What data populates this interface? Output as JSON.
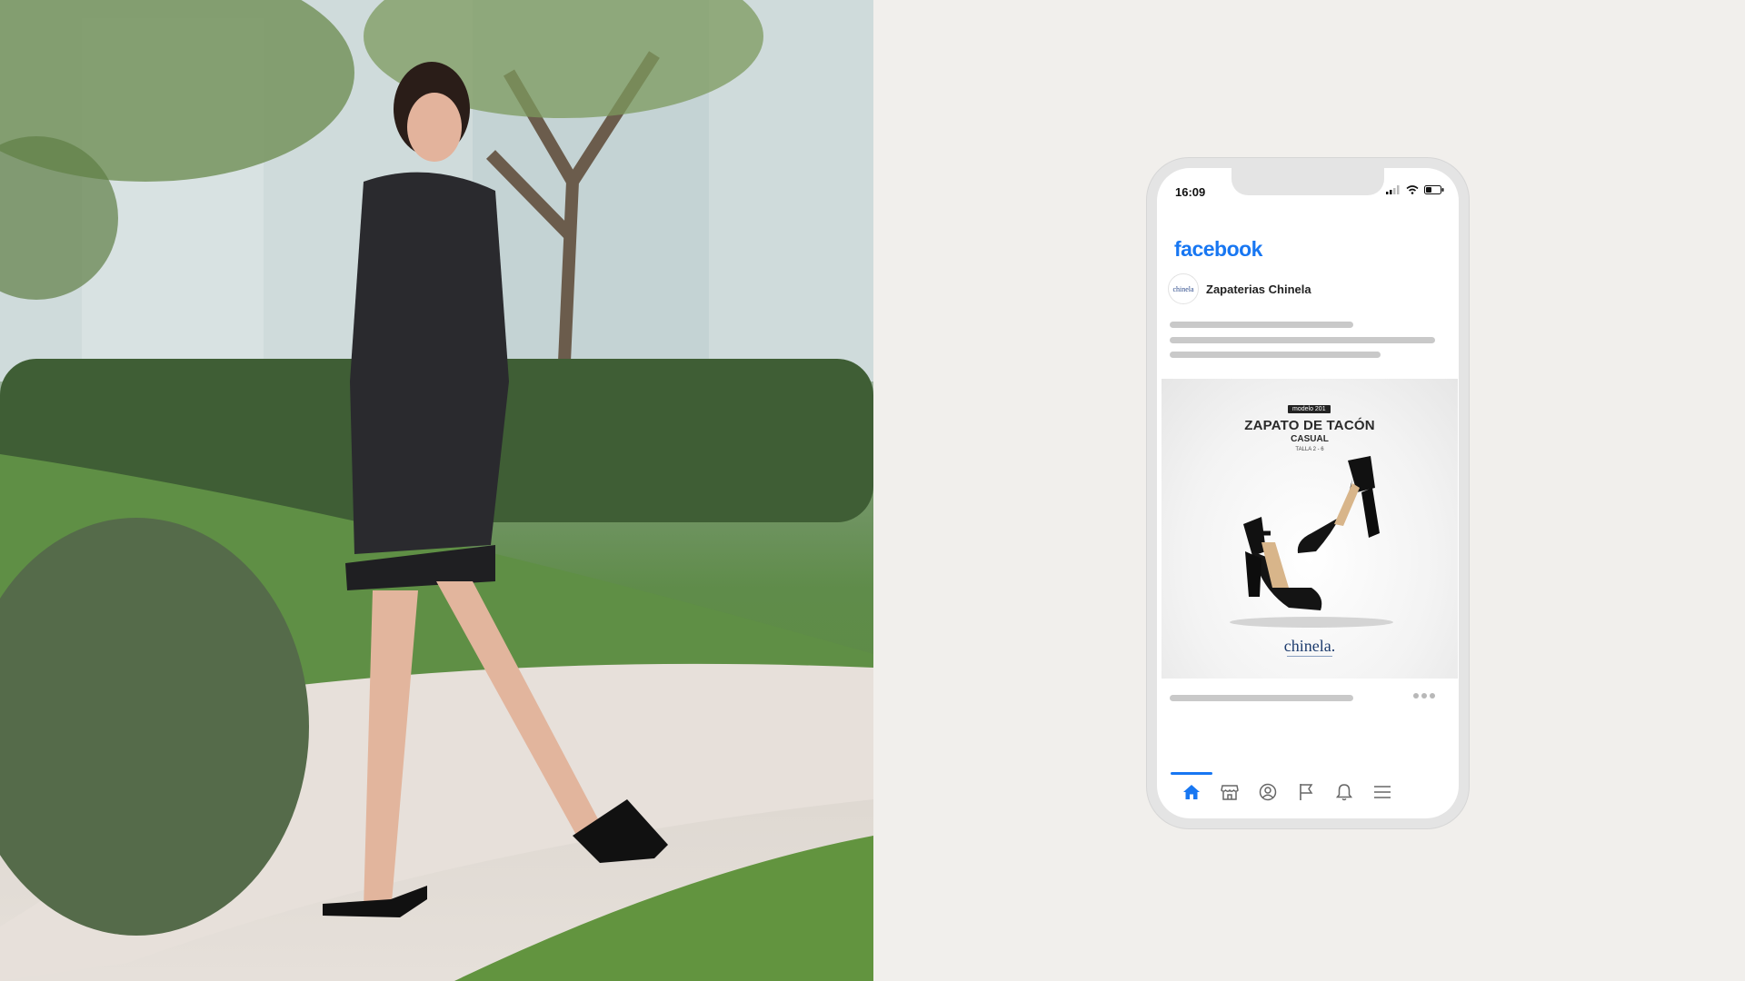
{
  "status": {
    "time": "16:09"
  },
  "app": {
    "name": "facebook"
  },
  "post": {
    "page_name": "Zapaterias Chinela",
    "avatar_text": "chinela"
  },
  "ad": {
    "tag": "modelo 201",
    "title": "ZAPATO DE TACÓN",
    "subtitle": "CASUAL",
    "size": "TALLA 2 - 6",
    "brand": "chinela."
  },
  "tabs": [
    {
      "icon": "home-icon",
      "active": true
    },
    {
      "icon": "marketplace-icon",
      "active": false
    },
    {
      "icon": "profile-icon",
      "active": false
    },
    {
      "icon": "flag-icon",
      "active": false
    },
    {
      "icon": "bell-icon",
      "active": false
    },
    {
      "icon": "menu-icon",
      "active": false
    }
  ],
  "colors": {
    "brand": "#1877f2",
    "background": "#f1efec",
    "skeleton": "#c9c9c9"
  }
}
